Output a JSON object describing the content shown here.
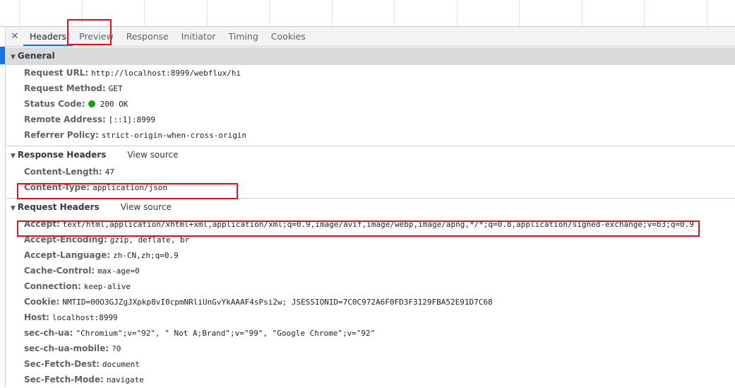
{
  "tabs": [
    "Headers",
    "Preview",
    "Response",
    "Initiator",
    "Timing",
    "Cookies"
  ],
  "active_tab": "Headers",
  "general": {
    "title": "General",
    "rows": [
      {
        "k": "Request URL:",
        "v": "http://localhost:8999/webflux/hi"
      },
      {
        "k": "Request Method:",
        "v": "GET"
      },
      {
        "k": "Status Code:",
        "v": "200 OK",
        "status_color": "#0fa30f"
      },
      {
        "k": "Remote Address:",
        "v": "[::1]:8999"
      },
      {
        "k": "Referrer Policy:",
        "v": "strict-origin-when-cross-origin"
      }
    ]
  },
  "response_headers": {
    "title": "Response Headers",
    "view_source": "View source",
    "rows": [
      {
        "k": "Content-Length:",
        "v": "47"
      },
      {
        "k": "Content-Type:",
        "v": "application/json"
      }
    ]
  },
  "request_headers": {
    "title": "Request Headers",
    "view_source": "View source",
    "rows": [
      {
        "k": "Accept:",
        "v": "text/html,application/xhtml+xml,application/xml;q=0.9,image/avif,image/webp,image/apng,*/*;q=0.8,application/signed-exchange;v=b3;q=0.9"
      },
      {
        "k": "Accept-Encoding:",
        "v": "gzip, deflate, br"
      },
      {
        "k": "Accept-Language:",
        "v": "zh-CN,zh;q=0.9"
      },
      {
        "k": "Cache-Control:",
        "v": "max-age=0"
      },
      {
        "k": "Connection:",
        "v": "keep-alive"
      },
      {
        "k": "Cookie:",
        "v": "NMTID=00O3GJZgJXpkp8vI0cpmNRliUnGvYkAAAF4sPsi2w; JSESSIONID=7C0C972A6F0FD3F3129FBA52E91D7C68"
      },
      {
        "k": "Host:",
        "v": "localhost:8999"
      },
      {
        "k": "sec-ch-ua:",
        "v": "\"Chromium\";v=\"92\", \" Not A;Brand\";v=\"99\", \"Google Chrome\";v=\"92\""
      },
      {
        "k": "sec-ch-ua-mobile:",
        "v": "?0"
      },
      {
        "k": "Sec-Fetch-Dest:",
        "v": "document"
      },
      {
        "k": "Sec-Fetch-Mode:",
        "v": "navigate"
      }
    ]
  }
}
